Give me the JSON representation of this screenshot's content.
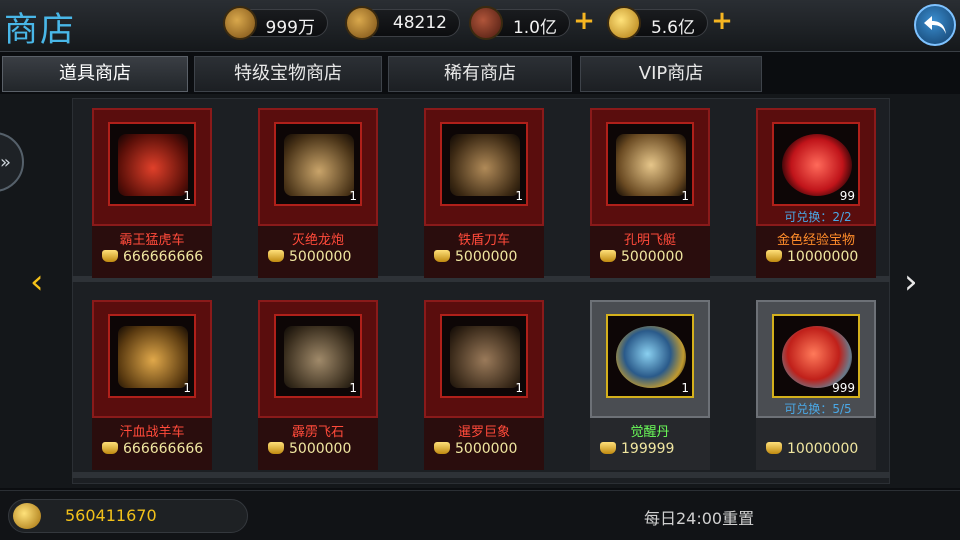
{
  "header": {
    "title": "商店",
    "resources": [
      {
        "icon": "treasure-chest-icon",
        "value": "999万"
      },
      {
        "icon": "hammer-material-icon",
        "value": "48212"
      },
      {
        "icon": "copper-coin-icon",
        "value": "1.0亿"
      },
      {
        "icon": "gold-ingot-icon",
        "value": "5.6亿"
      }
    ]
  },
  "tabs": [
    {
      "label": "道具商店",
      "active": true
    },
    {
      "label": "特级宝物商店",
      "active": false
    },
    {
      "label": "稀有商店",
      "active": false
    },
    {
      "label": "VIP商店",
      "active": false
    }
  ],
  "items": [
    {
      "name": "霸王猛虎车",
      "price": "666666666",
      "count": "1",
      "exchange": "",
      "frame": "red"
    },
    {
      "name": "灭绝龙炮",
      "price": "5000000",
      "count": "1",
      "exchange": "",
      "frame": "red"
    },
    {
      "name": "铁盾刀车",
      "price": "5000000",
      "count": "1",
      "exchange": "",
      "frame": "red"
    },
    {
      "name": "孔明飞艇",
      "price": "5000000",
      "count": "1",
      "exchange": "",
      "frame": "red"
    },
    {
      "name": "金色经验宝物",
      "price": "10000000",
      "count": "99",
      "exchange": "可兑换：2/2",
      "frame": "red"
    },
    {
      "name": "汗血战羊车",
      "price": "666666666",
      "count": "1",
      "exchange": "",
      "frame": "red"
    },
    {
      "name": "霹雳飞石",
      "price": "5000000",
      "count": "1",
      "exchange": "",
      "frame": "red"
    },
    {
      "name": "暹罗巨象",
      "price": "5000000",
      "count": "1",
      "exchange": "",
      "frame": "red"
    },
    {
      "name": "觉醒丹",
      "price": "199999",
      "count": "1",
      "exchange": "",
      "frame": "gray"
    },
    {
      "name": "",
      "price": "10000000",
      "count": "999",
      "exchange": "可兑换：5/5",
      "frame": "gray"
    }
  ],
  "footer": {
    "currency_value": "560411670",
    "reset_text": "每日24:00重置"
  },
  "colors": {
    "title": "#49b7e8",
    "item_name_red": "#ff4a3a",
    "item_name_green": "#6cff5a",
    "exchange_blue": "#4aa8e6",
    "gold": "#f3c21a"
  }
}
